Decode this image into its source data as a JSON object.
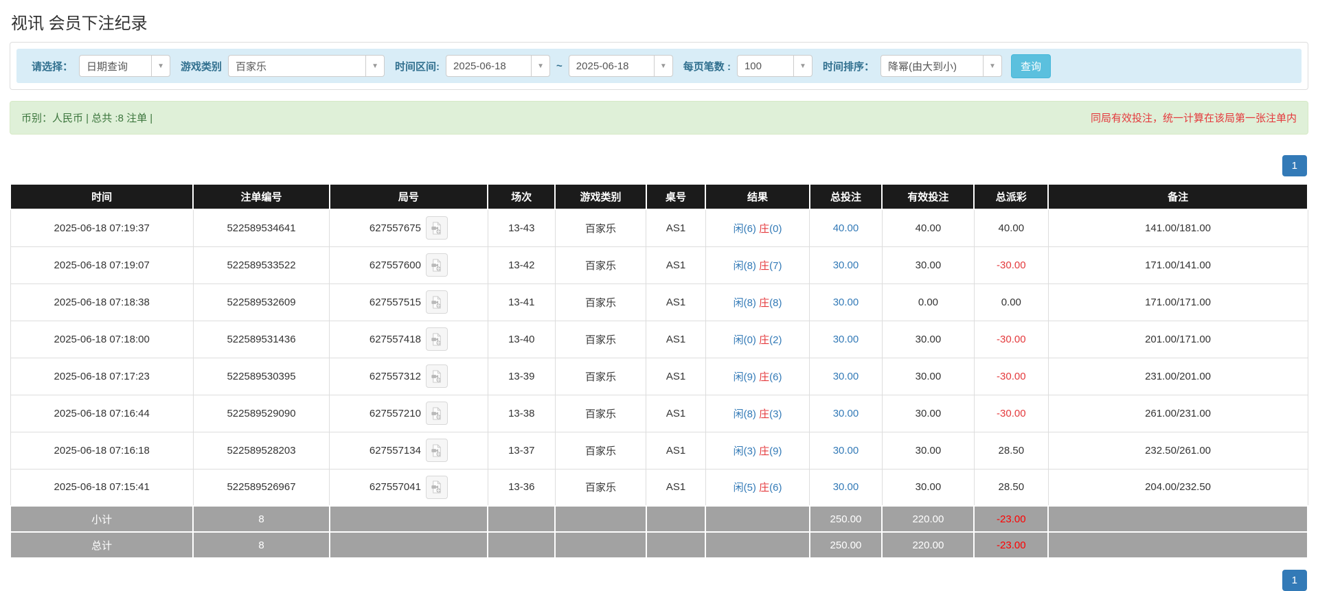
{
  "page": {
    "title": "视讯 会员下注纪录"
  },
  "filters": {
    "select_label": "请选择：",
    "select_value": "日期查询",
    "game_type_label": "游戏类别",
    "game_type_value": "百家乐",
    "time_range_label": "时间区间:",
    "date_from": "2025-06-18",
    "tilde": "~",
    "date_to": "2025-06-18",
    "page_size_label": "每页笔数 :",
    "page_size_value": "100",
    "sort_label": "时间排序：",
    "sort_value": "降幂(由大到小)",
    "search_button": "查询"
  },
  "summary": {
    "left": "币别：人民币 | 总共 :8 注单 |",
    "right": "同局有效投注，统一计算在该局第一张注单内"
  },
  "pagination": {
    "page": "1"
  },
  "table": {
    "headers": [
      "时间",
      "注单编号",
      "局号",
      "场次",
      "游戏类别",
      "桌号",
      "结果",
      "总投注",
      "有效投注",
      "总派彩",
      "备注"
    ],
    "rows": [
      {
        "time": "2025-06-18 07:19:37",
        "bet_id": "522589534641",
        "round_id": "627557675",
        "session": "13-43",
        "game_type": "百家乐",
        "table_no": "AS1",
        "result": {
          "p1": "闲(6)",
          "p2": "庄",
          "p3": "(0)"
        },
        "total_bet": "40.00",
        "valid_bet": "40.00",
        "payout": "40.00",
        "note": "141.00/181.00"
      },
      {
        "time": "2025-06-18 07:19:07",
        "bet_id": "522589533522",
        "round_id": "627557600",
        "session": "13-42",
        "game_type": "百家乐",
        "table_no": "AS1",
        "result": {
          "p1": "闲(8)",
          "p2": "庄",
          "p3": "(7)"
        },
        "total_bet": "30.00",
        "valid_bet": "30.00",
        "payout": "-30.00",
        "note": "171.00/141.00"
      },
      {
        "time": "2025-06-18 07:18:38",
        "bet_id": "522589532609",
        "round_id": "627557515",
        "session": "13-41",
        "game_type": "百家乐",
        "table_no": "AS1",
        "result": {
          "p1": "闲(8)",
          "p2": "庄",
          "p3": "(8)"
        },
        "total_bet": "30.00",
        "valid_bet": "0.00",
        "payout": "0.00",
        "note": "171.00/171.00"
      },
      {
        "time": "2025-06-18 07:18:00",
        "bet_id": "522589531436",
        "round_id": "627557418",
        "session": "13-40",
        "game_type": "百家乐",
        "table_no": "AS1",
        "result": {
          "p1": "闲(0)",
          "p2": "庄",
          "p3": "(2)"
        },
        "total_bet": "30.00",
        "valid_bet": "30.00",
        "payout": "-30.00",
        "note": "201.00/171.00"
      },
      {
        "time": "2025-06-18 07:17:23",
        "bet_id": "522589530395",
        "round_id": "627557312",
        "session": "13-39",
        "game_type": "百家乐",
        "table_no": "AS1",
        "result": {
          "p1": "闲(9)",
          "p2": "庄",
          "p3": "(6)"
        },
        "total_bet": "30.00",
        "valid_bet": "30.00",
        "payout": "-30.00",
        "note": "231.00/201.00"
      },
      {
        "time": "2025-06-18 07:16:44",
        "bet_id": "522589529090",
        "round_id": "627557210",
        "session": "13-38",
        "game_type": "百家乐",
        "table_no": "AS1",
        "result": {
          "p1": "闲(8)",
          "p2": "庄",
          "p3": "(3)"
        },
        "total_bet": "30.00",
        "valid_bet": "30.00",
        "payout": "-30.00",
        "note": "261.00/231.00"
      },
      {
        "time": "2025-06-18 07:16:18",
        "bet_id": "522589528203",
        "round_id": "627557134",
        "session": "13-37",
        "game_type": "百家乐",
        "table_no": "AS1",
        "result": {
          "p1": "闲(3)",
          "p2": "庄",
          "p3": "(9)"
        },
        "total_bet": "30.00",
        "valid_bet": "30.00",
        "payout": "28.50",
        "note": "232.50/261.00"
      },
      {
        "time": "2025-06-18 07:15:41",
        "bet_id": "522589526967",
        "round_id": "627557041",
        "session": "13-36",
        "game_type": "百家乐",
        "table_no": "AS1",
        "result": {
          "p1": "闲(5)",
          "p2": "庄",
          "p3": "(6)"
        },
        "total_bet": "30.00",
        "valid_bet": "30.00",
        "payout": "28.50",
        "note": "204.00/232.50"
      }
    ],
    "footer": [
      {
        "label": "小计",
        "count": "8",
        "total_bet": "250.00",
        "valid_bet": "220.00",
        "payout": "-23.00"
      },
      {
        "label": "总计",
        "count": "8",
        "total_bet": "250.00",
        "valid_bet": "220.00",
        "payout": "-23.00"
      }
    ]
  },
  "colors": {
    "filter_bar_bg": "#d9edf7",
    "filter_label": "#31708f",
    "search_button_bg": "#5bc0de",
    "alert_bg": "#dff0d8",
    "alert_text_green": "#3c763d",
    "alert_note_red": "#e4393c",
    "table_header_bg": "#1b1b1b",
    "footer_row_bg": "#a2a2a2",
    "link_blue": "#337ab7",
    "negative_red": "#e4393c",
    "pagination_blue": "#337ab7"
  }
}
